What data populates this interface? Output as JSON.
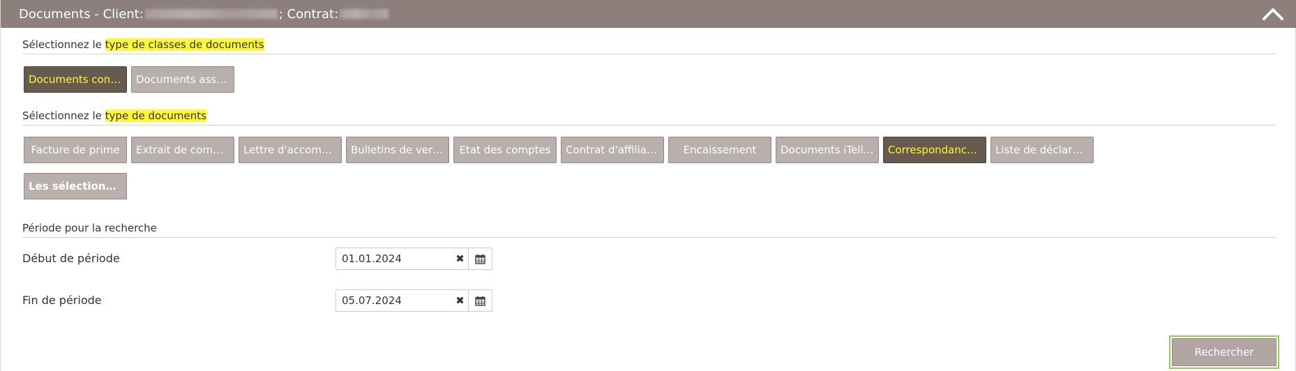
{
  "header": {
    "title_prefix": "Documents - Client:",
    "contract_label": "; Contrat:"
  },
  "class_section": {
    "label_prefix": "Sélectionnez le ",
    "label_highlight": "type de classes de documents",
    "buttons": [
      {
        "label": "Documents contra…",
        "selected": true
      },
      {
        "label": "Documents assurés",
        "selected": false
      }
    ]
  },
  "doc_section": {
    "label_prefix": "Sélectionnez le ",
    "label_highlight": "type de documents",
    "buttons": [
      {
        "label": "Facture de prime",
        "selected": false
      },
      {
        "label": "Extrait de compte",
        "selected": false
      },
      {
        "label": "Lettre d'accompag…",
        "selected": false
      },
      {
        "label": "Bulletins de verse…",
        "selected": false
      },
      {
        "label": "Etat des comptes",
        "selected": false
      },
      {
        "label": "Contrat d'affiliation",
        "selected": false
      },
      {
        "label": "Encaissement",
        "selected": false
      },
      {
        "label": "Documents iTellco…",
        "selected": false
      },
      {
        "label": "Correspondance r…",
        "selected": true
      },
      {
        "label": "Liste de déclaratio…",
        "selected": false
      }
    ],
    "select_all_label": "Les sélectionner t…"
  },
  "period": {
    "section_label": "Période pour la recherche",
    "start_label": "Début de période",
    "start_value": "01.01.2024",
    "end_label": "Fin de période",
    "end_value": "05.07.2024"
  },
  "search_label": "Rechercher",
  "colors": {
    "header_bg": "#8c7f7c",
    "button_bg": "#b9afac",
    "selected_bg": "#675a4f",
    "highlight": "#fff835",
    "focus_border": "#8fd24a"
  }
}
